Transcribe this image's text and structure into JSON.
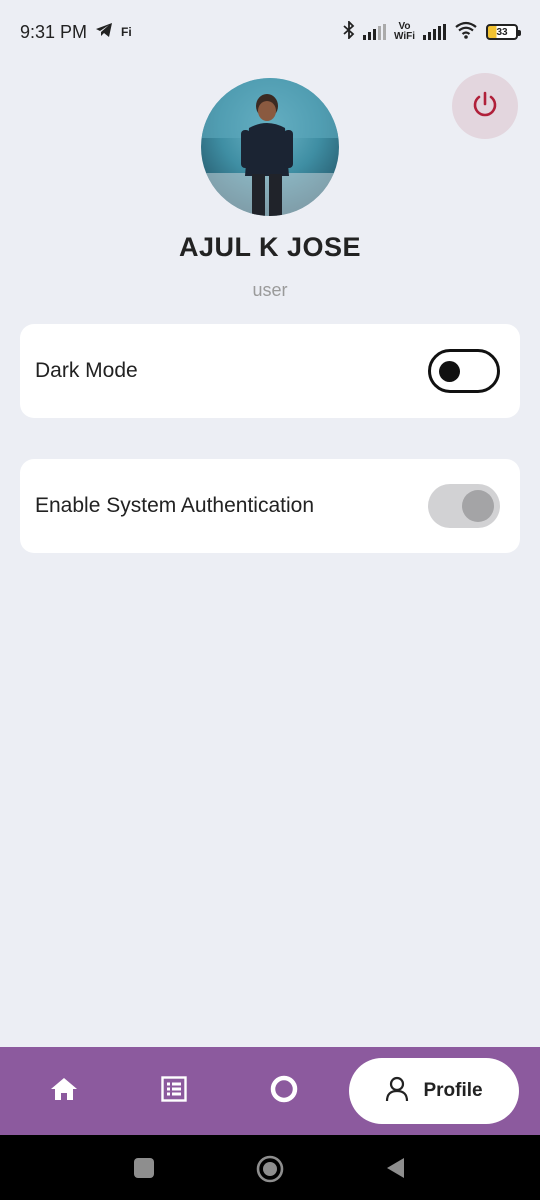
{
  "status_bar": {
    "time": "9:31 PM",
    "notification_icons": [
      "telegram-icon",
      "fi-icon"
    ],
    "fi_label": "Fi",
    "vowifi_top": "Vo",
    "vowifi_bottom": "WiFi",
    "battery_level": "33",
    "icons": [
      "bluetooth-icon",
      "signal-icon",
      "vowifi-icon",
      "signal-icon",
      "wifi-icon",
      "battery-icon"
    ]
  },
  "profile": {
    "name": "AJUL K JOSE",
    "role": "user",
    "logout_icon": "power-icon"
  },
  "settings": [
    {
      "label": "Dark Mode",
      "toggle_state": "off"
    },
    {
      "label": "Enable System Authentication",
      "toggle_state": "disabled"
    }
  ],
  "bottom_nav": {
    "items": [
      {
        "icon": "home-icon"
      },
      {
        "icon": "list-icon"
      },
      {
        "icon": "circle-icon"
      },
      {
        "icon": "person-icon",
        "label": "Profile",
        "active": true
      }
    ],
    "accent_color": "#8c5a9e"
  },
  "system_nav": [
    "recents-button",
    "home-button",
    "back-button"
  ]
}
